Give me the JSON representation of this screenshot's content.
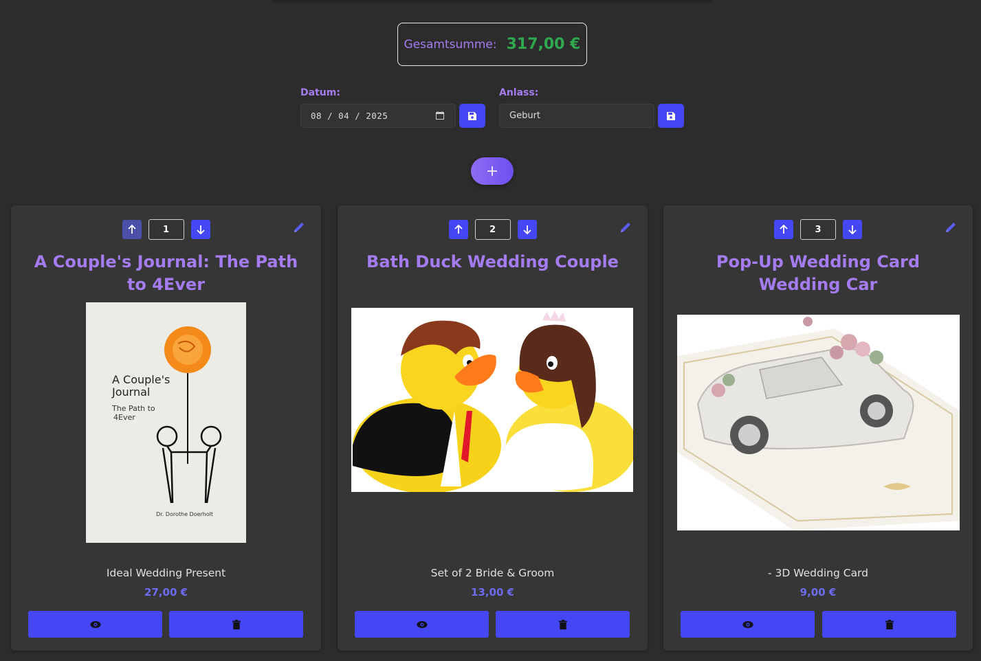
{
  "summary": {
    "label": "Gesamtsumme:",
    "value": "317,00 €"
  },
  "form": {
    "date_label": "Datum:",
    "date_value": "08 / 04 / 2025",
    "occasion_label": "Anlass:",
    "occasion_value": "Geburt"
  },
  "colors": {
    "accent": "#4547f5",
    "title_purple": "#a57cf0",
    "total_green": "#2fa84f",
    "background": "#2c2c2c",
    "card": "#363636"
  },
  "items": [
    {
      "position": "1",
      "title": "A Couple's Journal: The Path to 4Ever",
      "description": "Ideal Wedding Present",
      "price": "27,00 €",
      "image_text": {
        "title1": "A Couple's",
        "title2": "Journal",
        "sub1": "The Path to",
        "sub2": "4Ever",
        "author": "Dr. Dorothe Doerholt"
      }
    },
    {
      "position": "2",
      "title": "Bath Duck Wedding Couple",
      "description": "Set of 2 Bride & Groom",
      "price": "13,00 €"
    },
    {
      "position": "3",
      "title": "Pop-Up Wedding Card Wedding Car",
      "description": "- 3D Wedding Card",
      "price": "9,00 €"
    }
  ],
  "icons": [
    "arrow-up-icon",
    "arrow-down-icon",
    "pencil-icon",
    "eye-icon",
    "trash-icon",
    "floppy-disk-icon",
    "calendar-icon",
    "plus-icon"
  ]
}
